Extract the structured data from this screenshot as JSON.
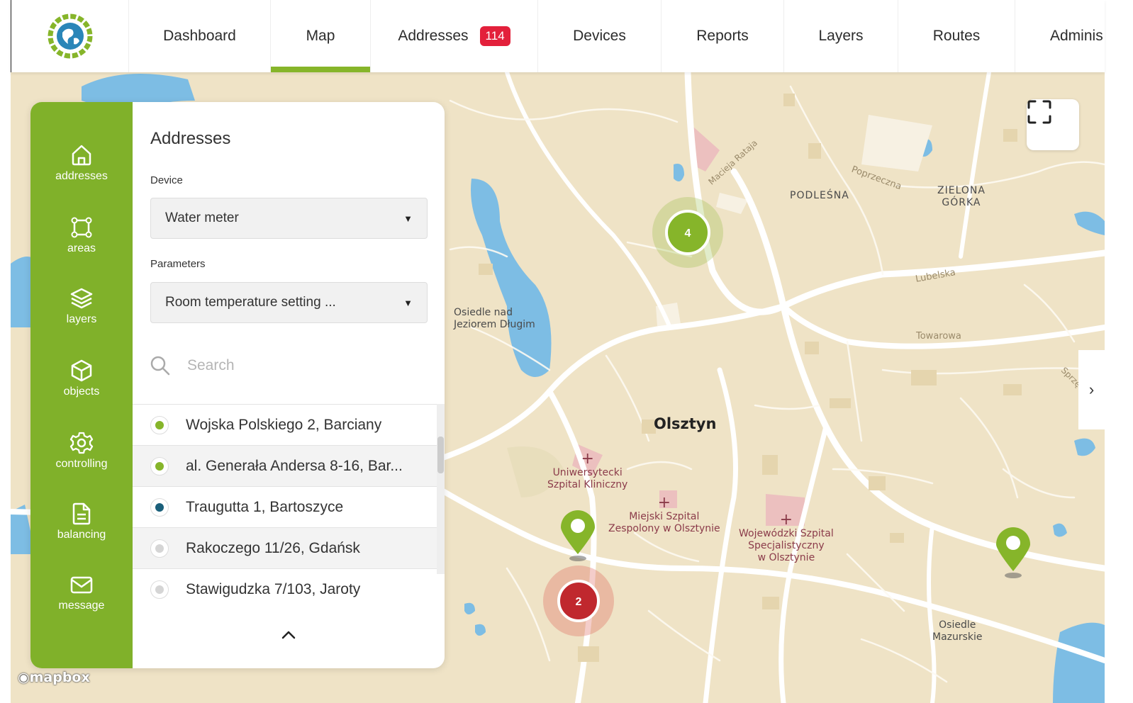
{
  "nav": {
    "items": [
      {
        "label": "Dashboard"
      },
      {
        "label": "Map"
      },
      {
        "label": "Addresses",
        "badge": "114"
      },
      {
        "label": "Devices"
      },
      {
        "label": "Reports"
      },
      {
        "label": "Layers"
      },
      {
        "label": "Routes"
      },
      {
        "label": "Adminis"
      }
    ],
    "active": "Map",
    "accent": "#86b52a",
    "badge_color": "#e3203b"
  },
  "sidebar": {
    "color": "#80b12a",
    "items": [
      {
        "label": "addresses",
        "icon": "home-icon"
      },
      {
        "label": "areas",
        "icon": "area-icon"
      },
      {
        "label": "layers",
        "icon": "layers-icon"
      },
      {
        "label": "objects",
        "icon": "cube-icon"
      },
      {
        "label": "controlling",
        "icon": "gear-icon"
      },
      {
        "label": "balancing",
        "icon": "document-icon"
      },
      {
        "label": "message",
        "icon": "mail-icon"
      }
    ]
  },
  "panel": {
    "title": "Addresses",
    "device_label": "Device",
    "device_value": "Water meter",
    "params_label": "Parameters",
    "params_value": "Room temperature setting ...",
    "search_placeholder": "Search",
    "addresses": [
      {
        "text": "Wojska Polskiego 2, Barciany",
        "status_color": "#86b52a"
      },
      {
        "text": "al. Generała Andersa 8-16, Bar...",
        "status_color": "#86b52a"
      },
      {
        "text": "Traugutta 1, Bartoszyce",
        "status_color": "#1a5f7a"
      },
      {
        "text": "Rakoczego 11/26, Gdańsk",
        "status_color": "#d5d5d5"
      },
      {
        "text": "Stawigudzka 7/103, Jaroty",
        "status_color": "#d5d5d5"
      }
    ]
  },
  "map": {
    "labels": {
      "city": "Olsztyn",
      "osiedle_nad_1": "Osiedle nad",
      "osiedle_nad_2": "Jeziorem Długim",
      "podlesna": "PODLEŚNA",
      "zielona_1": "ZIELONA",
      "zielona_2": "GÓRKA",
      "lubelska": "Lubelska",
      "towarowa": "Towarowa",
      "poprzeczna": "Poprzeczna",
      "macieja": "Macieja Rataja",
      "sprzet": "Sprzęt",
      "uniw_1": "Uniwersytecki",
      "uniw_2": "Szpital Kliniczny",
      "miejski_1": "Miejski Szpital",
      "miejski_2": "Zespolony w Olsztynie",
      "woj_1": "Wojewódzki Szpital",
      "woj_2": "Specjalistyczny",
      "woj_3": "w Olsztynie",
      "mazurskie_1": "Osiedle",
      "mazurskie_2": "Mazurskie"
    },
    "clusters": [
      {
        "count": "4",
        "color": "#86b52a"
      },
      {
        "count": "2",
        "color": "#c0282e"
      }
    ],
    "attribution": "mapbox",
    "land": "#efe3c6",
    "water": "#7dbde4"
  }
}
